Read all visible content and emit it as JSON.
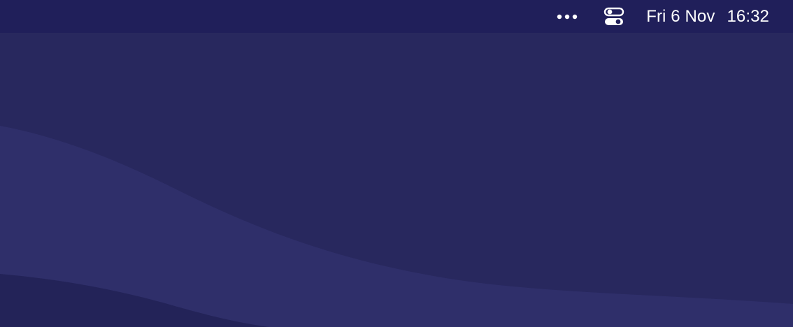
{
  "menubar": {
    "more_icon": "more-options-icon",
    "control_center_icon": "control-center-icon",
    "clock": {
      "date": "Fri 6 Nov",
      "time": "16:32"
    }
  },
  "colors": {
    "menubar_background": "#201f5a",
    "desktop_background": "#28285e",
    "wallpaper_wave_light": "#2f2f6a",
    "wallpaper_wave_dark": "#232358",
    "menu_text": "#ffffff"
  }
}
